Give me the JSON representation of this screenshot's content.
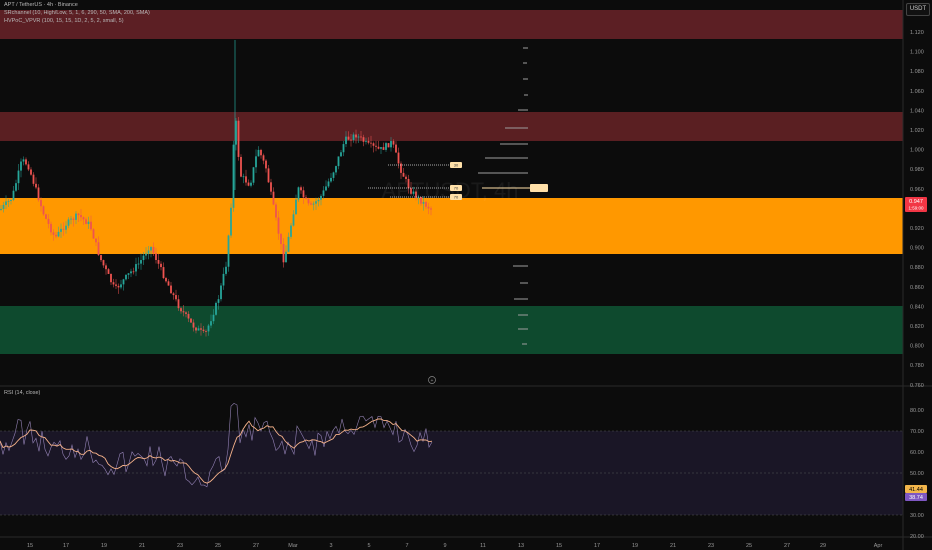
{
  "header": {
    "symbol_line": "APT / TetherUS · 4h · Binance",
    "indicator_1": "SRchannel (10, High/Low, 5, 1, 6, 290, 50, SMA, 200, SMA)",
    "indicator_2": "HVPoC_VPVR (100, 15, 15, 1D, 2, 5, 2, small, 5)",
    "unit_button": "USDT",
    "watermark": "APTUSDT, 4h"
  },
  "price_axis": {
    "ticks": [
      "1.120",
      "1.100",
      "1.080",
      "1.060",
      "1.040",
      "1.020",
      "1.000",
      "0.980",
      "0.960",
      "0.940",
      "0.920",
      "0.900",
      "0.880",
      "0.860",
      "0.840",
      "0.820",
      "0.800",
      "0.780",
      "0.760"
    ],
    "last_price_label": "0.947",
    "last_price_sub": "1:59:00",
    "last_price_color": "#f23645"
  },
  "rsi_pane": {
    "title": "RSI (14, close)",
    "ticks": [
      "80.00",
      "70.00",
      "60.00",
      "50.00",
      "40.00",
      "30.00",
      "20.00"
    ],
    "rsi_value": "41.44",
    "ma_value": "38.74",
    "rsi_value_color": "#7e57c2",
    "ma_value_color": "#f4b860"
  },
  "time_axis": {
    "labels": [
      "15",
      "17",
      "19",
      "21",
      "23",
      "25",
      "27",
      "Mar",
      "3",
      "5",
      "7",
      "9",
      "11",
      "13",
      "15",
      "17",
      "19",
      "21",
      "23",
      "25",
      "27",
      "29",
      "Apr"
    ]
  },
  "vpvr_labels": [
    "30",
    "70",
    "70"
  ],
  "add_icon": "plus-circle-icon",
  "colors": {
    "up": "#26a69a",
    "down": "#ef5350",
    "resistance_zone": "#5c1f24",
    "support_zone": "#0e4a2e",
    "current_zone": "#ff9800",
    "rsi_line": "#b39ddb",
    "rsi_ma": "#f7b38b"
  }
}
